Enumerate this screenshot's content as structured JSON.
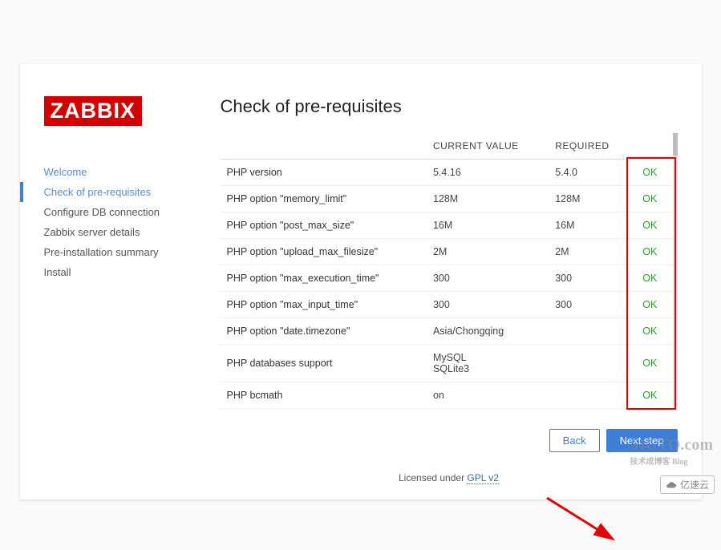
{
  "logo": "ZABBIX",
  "heading": "Check of pre-requisites",
  "steps": [
    {
      "label": "Welcome",
      "state": "past"
    },
    {
      "label": "Check of pre-requisites",
      "state": "current"
    },
    {
      "label": "Configure DB connection",
      "state": "future"
    },
    {
      "label": "Zabbix server details",
      "state": "future"
    },
    {
      "label": "Pre-installation summary",
      "state": "future"
    },
    {
      "label": "Install",
      "state": "future"
    }
  ],
  "table": {
    "headers": {
      "name": "",
      "current": "CURRENT VALUE",
      "required": "REQUIRED",
      "status": ""
    },
    "rows": [
      {
        "name": "PHP version",
        "current": "5.4.16",
        "required": "5.4.0",
        "status": "OK"
      },
      {
        "name": "PHP option \"memory_limit\"",
        "current": "128M",
        "required": "128M",
        "status": "OK"
      },
      {
        "name": "PHP option \"post_max_size\"",
        "current": "16M",
        "required": "16M",
        "status": "OK"
      },
      {
        "name": "PHP option \"upload_max_filesize\"",
        "current": "2M",
        "required": "2M",
        "status": "OK"
      },
      {
        "name": "PHP option \"max_execution_time\"",
        "current": "300",
        "required": "300",
        "status": "OK"
      },
      {
        "name": "PHP option \"max_input_time\"",
        "current": "300",
        "required": "300",
        "status": "OK"
      },
      {
        "name": "PHP option \"date.timezone\"",
        "current": "Asia/Chongqing",
        "required": "",
        "status": "OK"
      },
      {
        "name": "PHP databases support",
        "current": "MySQL\nSQLite3",
        "required": "",
        "status": "OK"
      },
      {
        "name": "PHP bcmath",
        "current": "on",
        "required": "",
        "status": "OK"
      }
    ]
  },
  "buttons": {
    "back": "Back",
    "next": "Next step"
  },
  "license": {
    "text": "Licensed under ",
    "link": "GPL v2"
  },
  "watermarks": {
    "w1": "51CTO.com",
    "w1sub": "技术成博客  Blog",
    "w2": "亿速云"
  }
}
